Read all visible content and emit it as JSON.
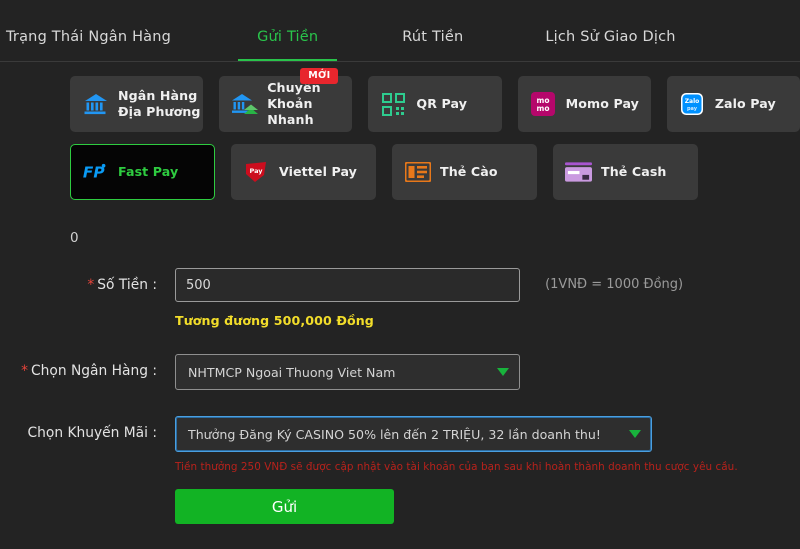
{
  "tabs": [
    {
      "label": "Trạng Thái Ngân Hàng",
      "active": false
    },
    {
      "label": "Gửi Tiền",
      "active": true
    },
    {
      "label": "Rút Tiền",
      "active": false
    },
    {
      "label": "Lịch Sử Giao Dịch",
      "active": false
    }
  ],
  "methods": {
    "row1": [
      {
        "label_line1": "Ngân Hàng",
        "label_line2": "Địa Phương",
        "icon": "bank-icon",
        "icon_color": "#2196f3",
        "selected": false,
        "badge": ""
      },
      {
        "label_line1": "Chuyển Khoản",
        "label_line2": "Nhanh",
        "icon": "fast-bank-icon",
        "icon_color": "#2196f3",
        "selected": false,
        "badge": "MỚI"
      },
      {
        "label_line1": "QR Pay",
        "label_line2": "",
        "icon": "qr-code-icon",
        "icon_color": "#2ecc8f",
        "selected": false,
        "badge": ""
      },
      {
        "label_line1": "Momo Pay",
        "label_line2": "",
        "icon": "momo-icon",
        "icon_color": "#b5076b",
        "selected": false,
        "badge": ""
      },
      {
        "label_line1": "Zalo Pay",
        "label_line2": "",
        "icon": "zalo-icon",
        "icon_color": "#0091ff",
        "selected": false,
        "badge": ""
      }
    ],
    "row2": [
      {
        "label_line1": "Fast Pay",
        "label_line2": "",
        "icon": "fastpay-icon",
        "icon_color": "#0a9bf5",
        "selected": true,
        "badge": ""
      },
      {
        "label_line1": "Viettel Pay",
        "label_line2": "",
        "icon": "viettel-icon",
        "icon_color": "#cc0d1e",
        "selected": false,
        "badge": ""
      },
      {
        "label_line1": "Thẻ Cào",
        "label_line2": "",
        "icon": "scratch-card-icon",
        "icon_color": "#e8781a",
        "selected": false,
        "badge": ""
      },
      {
        "label_line1": "Thẻ Cash",
        "label_line2": "",
        "icon": "cash-card-icon",
        "icon_color": "#c48be0",
        "selected": false,
        "badge": ""
      }
    ]
  },
  "form": {
    "balance": "0",
    "amount_label": "Số Tiền :",
    "amount_value": "500",
    "amount_placeholder": "500",
    "rate_hint": "(1VNĐ = 1000 Đồng)",
    "equivalent": "Tương đương 500,000 Đồng",
    "bank_label": "Chọn Ngân Hàng :",
    "bank_value": "NHTMCP Ngoai Thuong Viet Nam",
    "promo_label": "Chọn Khuyến Mãi :",
    "promo_value": "Thưởng Đăng Ký CASINO 50% lên đến 2 TRIỆU, 32 lần doanh thu!",
    "promo_note": "Tiền thưởng 250 VNĐ sẽ được cập nhật vào tài khoản của bạn sau khi hoàn thành doanh thu cược yêu cầu.",
    "submit_label": "Gửi",
    "required_mark": "*"
  },
  "colors": {
    "accent_green": "#2ecc40",
    "background": "#232323",
    "card": "#3a3a3a",
    "yellow": "#f2dd2a",
    "red": "#b8221c",
    "badge_red": "#e8262d",
    "focus_blue": "#4a9fe0"
  }
}
